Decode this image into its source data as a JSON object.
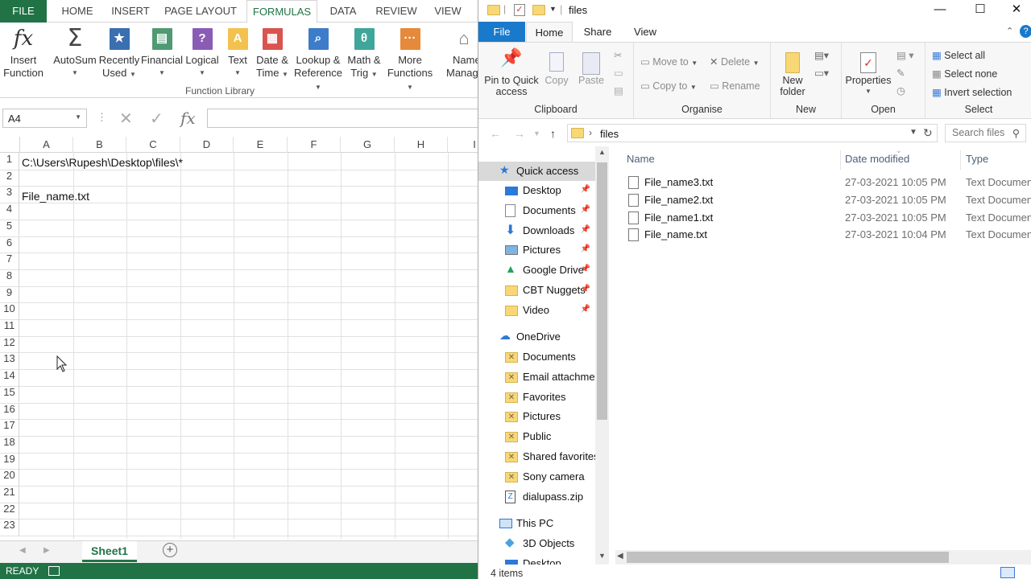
{
  "excel": {
    "tabs": [
      "FILE",
      "HOME",
      "INSERT",
      "PAGE LAYOUT",
      "FORMULAS",
      "DATA",
      "REVIEW",
      "VIEW"
    ],
    "active_tab": "FORMULAS",
    "ribbon": {
      "insert_function": [
        "Insert",
        "Function"
      ],
      "autosum": "AutoSum",
      "recently_used": [
        "Recently",
        "Used"
      ],
      "financial": "Financial",
      "logical": "Logical",
      "text": "Text",
      "date_time": [
        "Date &",
        "Time"
      ],
      "lookup": [
        "Lookup &",
        "Reference"
      ],
      "math": [
        "Math &",
        "Trig"
      ],
      "more": [
        "More",
        "Functions"
      ],
      "name_manager": [
        "Name",
        "Manag"
      ],
      "group_label": "Function Library"
    },
    "name_box": "A4",
    "columns": [
      "A",
      "B",
      "C",
      "D",
      "E",
      "F",
      "G",
      "H",
      "I"
    ],
    "rows": [
      "1",
      "2",
      "3",
      "4",
      "5",
      "6",
      "7",
      "8",
      "9",
      "10",
      "11",
      "12",
      "13",
      "14",
      "15",
      "16",
      "17",
      "18",
      "19",
      "20",
      "21",
      "22",
      "23"
    ],
    "cells": {
      "A1": "C:\\Users\\Rupesh\\Desktop\\files\\*",
      "A3": "File_name.txt"
    },
    "sheet_tab": "Sheet1",
    "status": "READY"
  },
  "explorer": {
    "title": "files",
    "tabs": [
      "File",
      "Home",
      "Share",
      "View"
    ],
    "active_tab": "Home",
    "ribbon": {
      "pin": [
        "Pin to Quick",
        "access"
      ],
      "copy": "Copy",
      "paste": "Paste",
      "clipboard": "Clipboard",
      "move_to": "Move to",
      "copy_to": "Copy to",
      "delete": "Delete",
      "rename": "Rename",
      "organise": "Organise",
      "new_folder": [
        "New",
        "folder"
      ],
      "new": "New",
      "properties": "Properties",
      "open": "Open",
      "select_all": "Select all",
      "select_none": "Select none",
      "invert_selection": "Invert selection",
      "select": "Select"
    },
    "address": "files",
    "search_placeholder": "Search files",
    "nav": {
      "quick_access": "Quick access",
      "quick_items": [
        "Desktop",
        "Documents",
        "Downloads",
        "Pictures",
        "Google Drive",
        "CBT Nuggets",
        "Video"
      ],
      "onedrive": "OneDrive",
      "onedrive_items": [
        "Documents",
        "Email attachmer",
        "Favorites",
        "Pictures",
        "Public",
        "Shared favorites",
        "Sony camera",
        "dialupass.zip"
      ],
      "this_pc": "This PC",
      "pc_items": [
        "3D Objects",
        "Desktop"
      ]
    },
    "columns": [
      "Name",
      "Date modified",
      "Type"
    ],
    "files": [
      {
        "name": "File_name3.txt",
        "date": "27-03-2021 10:05 PM",
        "type": "Text Document"
      },
      {
        "name": "File_name2.txt",
        "date": "27-03-2021 10:05 PM",
        "type": "Text Document"
      },
      {
        "name": "File_name1.txt",
        "date": "27-03-2021 10:05 PM",
        "type": "Text Document"
      },
      {
        "name": "File_name.txt",
        "date": "27-03-2021 10:04 PM",
        "type": "Text Document"
      }
    ],
    "status": "4 items"
  }
}
